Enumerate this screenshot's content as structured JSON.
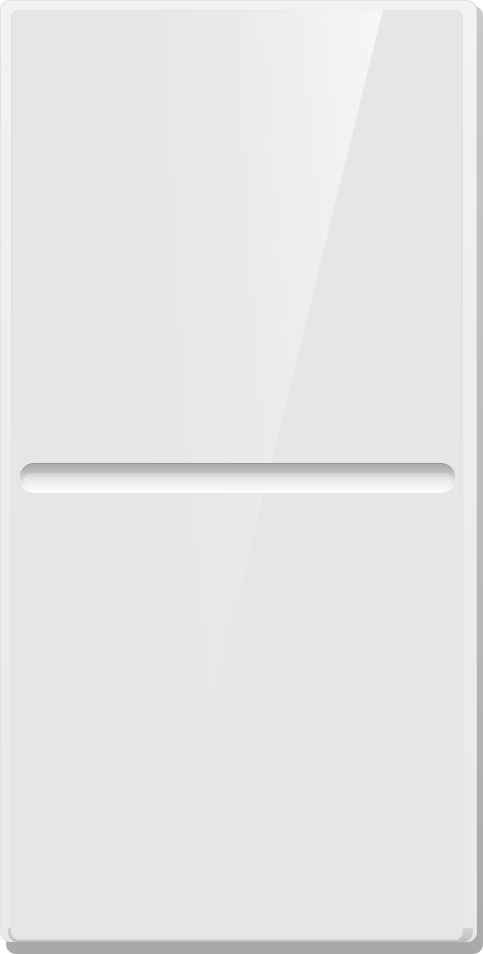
{
  "colors": {
    "panel": "#e6e6e6",
    "casing": "#efefef",
    "shadow": "#b9b9b9",
    "divider_dark": "#a9a9a9",
    "divider_light": "#ffffff"
  }
}
